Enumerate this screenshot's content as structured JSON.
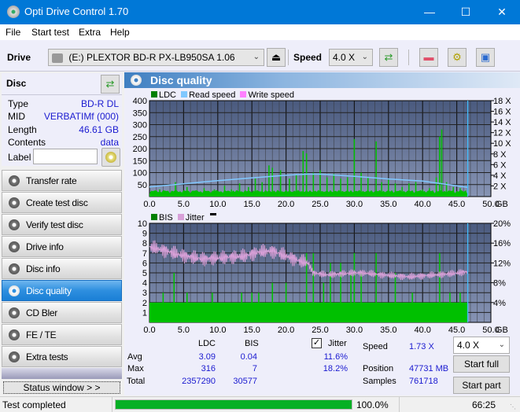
{
  "window": {
    "title": "Opti Drive Control 1.70",
    "minimize": "—",
    "maximize": "☐",
    "close": "✕"
  },
  "menu": [
    "File",
    "Start test",
    "Extra",
    "Help"
  ],
  "toolbar": {
    "drive_label": "Drive",
    "drive_value": "(E:)  PLEXTOR BD-R  PX-LB950SA 1.06",
    "speed_label": "Speed",
    "speed_value": "4.0 X",
    "eject_icon": "⏏",
    "refresh_icon": "⇄",
    "erase_icon": "▬",
    "settings_icon": "⚙",
    "save_icon": "▣"
  },
  "disc": {
    "header": "Disc",
    "rows": [
      {
        "label": "Type",
        "value": "BD-R DL"
      },
      {
        "label": "MID",
        "value": "VERBATIMf (000)"
      },
      {
        "label": "Length",
        "value": "46.61 GB"
      },
      {
        "label": "Contents",
        "value": "data"
      }
    ],
    "label_field_label": "Label",
    "label_field_value": ""
  },
  "nav": [
    {
      "label": "Transfer rate",
      "active": false
    },
    {
      "label": "Create test disc",
      "active": false
    },
    {
      "label": "Verify test disc",
      "active": false
    },
    {
      "label": "Drive info",
      "active": false
    },
    {
      "label": "Disc info",
      "active": false
    },
    {
      "label": "Disc quality",
      "active": true
    },
    {
      "label": "CD Bler",
      "active": false
    },
    {
      "label": "FE / TE",
      "active": false
    },
    {
      "label": "Extra tests",
      "active": false
    }
  ],
  "status_window_button": "Status window > >",
  "main": {
    "title": "Disc quality"
  },
  "chart_data": [
    {
      "type": "bar",
      "title": "LDC",
      "legend": [
        "LDC",
        "Read speed",
        "Write speed"
      ],
      "legend_colors": [
        "#008000",
        "#80c8ff",
        "#ff80ff"
      ],
      "xlabel": "GB",
      "x_ticks": [
        "0.0",
        "5.0",
        "10.0",
        "15.0",
        "20.0",
        "25.0",
        "30.0",
        "35.0",
        "40.0",
        "45.0",
        "50.0"
      ],
      "xlim": [
        0,
        50
      ],
      "ylim": [
        0,
        400
      ],
      "y_ticks": [
        "50",
        "100",
        "150",
        "200",
        "250",
        "300",
        "350",
        "400"
      ],
      "y2_ticks": [
        "2 X",
        "4 X",
        "6 X",
        "8 X",
        "10 X",
        "12 X",
        "14 X",
        "16 X",
        "18 X"
      ],
      "y2lim": [
        0,
        18
      ],
      "end_marker_gb": 46.61,
      "ldc_spikes": [
        [
          0.5,
          20
        ],
        [
          1.5,
          30
        ],
        [
          2.5,
          22
        ],
        [
          3.8,
          60
        ],
        [
          5.5,
          40
        ],
        [
          6.5,
          25
        ],
        [
          8.0,
          35
        ],
        [
          9.5,
          30
        ],
        [
          11.0,
          45
        ],
        [
          12.0,
          30
        ],
        [
          13.2,
          55
        ],
        [
          14.5,
          40
        ],
        [
          15.5,
          75
        ],
        [
          16.5,
          60
        ],
        [
          17.5,
          130
        ],
        [
          18.0,
          120
        ],
        [
          19.2,
          110
        ],
        [
          20.5,
          75
        ],
        [
          21.5,
          90
        ],
        [
          22.5,
          190
        ],
        [
          23.0,
          180
        ],
        [
          24.0,
          100
        ],
        [
          25.0,
          110
        ],
        [
          26.0,
          80
        ],
        [
          27.0,
          95
        ],
        [
          28.0,
          75
        ],
        [
          29.0,
          80
        ],
        [
          30.0,
          240
        ],
        [
          31.0,
          100
        ],
        [
          32.0,
          80
        ],
        [
          33.2,
          230
        ],
        [
          34.0,
          60
        ],
        [
          35.0,
          70
        ],
        [
          36.0,
          55
        ],
        [
          37.0,
          40
        ],
        [
          38.0,
          55
        ],
        [
          39.0,
          60
        ],
        [
          40.0,
          30
        ],
        [
          41.0,
          35
        ],
        [
          42.0,
          80
        ],
        [
          42.5,
          250
        ],
        [
          42.8,
          280
        ],
        [
          43.5,
          60
        ],
        [
          44.5,
          40
        ],
        [
          45.5,
          35
        ],
        [
          46.3,
          25
        ]
      ],
      "read_speed": [
        [
          0,
          1.8
        ],
        [
          5,
          2.4
        ],
        [
          10,
          3.0
        ],
        [
          15,
          3.5
        ],
        [
          20,
          4.0
        ],
        [
          23,
          4.2
        ],
        [
          25,
          4.2
        ],
        [
          30,
          3.8
        ],
        [
          35,
          3.3
        ],
        [
          40,
          2.9
        ],
        [
          45,
          2.0
        ],
        [
          46.6,
          1.73
        ]
      ]
    },
    {
      "type": "bar",
      "title": "BIS / Jitter",
      "legend": [
        "BIS",
        "Jitter"
      ],
      "legend_colors": [
        "#008000",
        "#d8a0d8"
      ],
      "xlabel": "GB",
      "x_ticks": [
        "0.0",
        "5.0",
        "10.0",
        "15.0",
        "20.0",
        "25.0",
        "30.0",
        "35.0",
        "40.0",
        "45.0",
        "50.0"
      ],
      "xlim": [
        0,
        50
      ],
      "ylim": [
        0,
        10
      ],
      "y_ticks": [
        "1",
        "2",
        "3",
        "4",
        "5",
        "6",
        "7",
        "8",
        "9",
        "10"
      ],
      "y2_ticks": [
        "4%",
        "8%",
        "12%",
        "16%",
        "20%"
      ],
      "y2lim": [
        0,
        20
      ],
      "end_marker_gb": 46.61,
      "bis_baseline": 2,
      "bis_spikes": [
        [
          2.0,
          3
        ],
        [
          3.6,
          5
        ],
        [
          5.5,
          3
        ],
        [
          9.2,
          3
        ],
        [
          13.5,
          3
        ],
        [
          15.0,
          3
        ],
        [
          16.0,
          3
        ],
        [
          18.0,
          4
        ],
        [
          20.0,
          4
        ],
        [
          23.0,
          7
        ],
        [
          24.0,
          7
        ],
        [
          25.5,
          4
        ],
        [
          26.5,
          6
        ],
        [
          28.0,
          6
        ],
        [
          29.5,
          5
        ],
        [
          30.0,
          7
        ],
        [
          31.0,
          5
        ],
        [
          33.2,
          7
        ],
        [
          36.0,
          5
        ],
        [
          38.5,
          3
        ],
        [
          42.5,
          7
        ],
        [
          44.0,
          3
        ],
        [
          45.5,
          3
        ]
      ],
      "jitter": [
        [
          0,
          15.2
        ],
        [
          2,
          14.6
        ],
        [
          4,
          13.8
        ],
        [
          6,
          13.2
        ],
        [
          8,
          12.8
        ],
        [
          10,
          13.0
        ],
        [
          12,
          13.2
        ],
        [
          14,
          13.4
        ],
        [
          16,
          14.2
        ],
        [
          18,
          14.4
        ],
        [
          20,
          13.4
        ],
        [
          22,
          12.4
        ],
        [
          23.2,
          12.0
        ],
        [
          24,
          10.0
        ],
        [
          26,
          9.6
        ],
        [
          28,
          9.8
        ],
        [
          30,
          10.0
        ],
        [
          32,
          9.9
        ],
        [
          34,
          9.6
        ],
        [
          36,
          9.4
        ],
        [
          38,
          9.2
        ],
        [
          40,
          9.4
        ],
        [
          42,
          9.6
        ],
        [
          44,
          9.8
        ],
        [
          46.5,
          10.2
        ]
      ]
    }
  ],
  "stats": {
    "col_ldc": "LDC",
    "col_bis": "BIS",
    "jitter_label": "Jitter",
    "jitter_checked": true,
    "rows": [
      {
        "label": "Avg",
        "ldc": "3.09",
        "bis": "0.04",
        "jitter": "11.6%"
      },
      {
        "label": "Max",
        "ldc": "316",
        "bis": "7",
        "jitter": "18.2%"
      },
      {
        "label": "Total",
        "ldc": "2357290",
        "bis": "30577",
        "jitter": ""
      }
    ],
    "speed_label": "Speed",
    "speed_value": "1.73 X",
    "position_label": "Position",
    "position_value": "47731 MB",
    "samples_label": "Samples",
    "samples_value": "761718",
    "speed_select": "4.0 X",
    "start_full": "Start full",
    "start_part": "Start part"
  },
  "statusbar": {
    "text": "Test completed",
    "progress": 1.0,
    "progress_text": "100.0%",
    "time": "66:25"
  }
}
